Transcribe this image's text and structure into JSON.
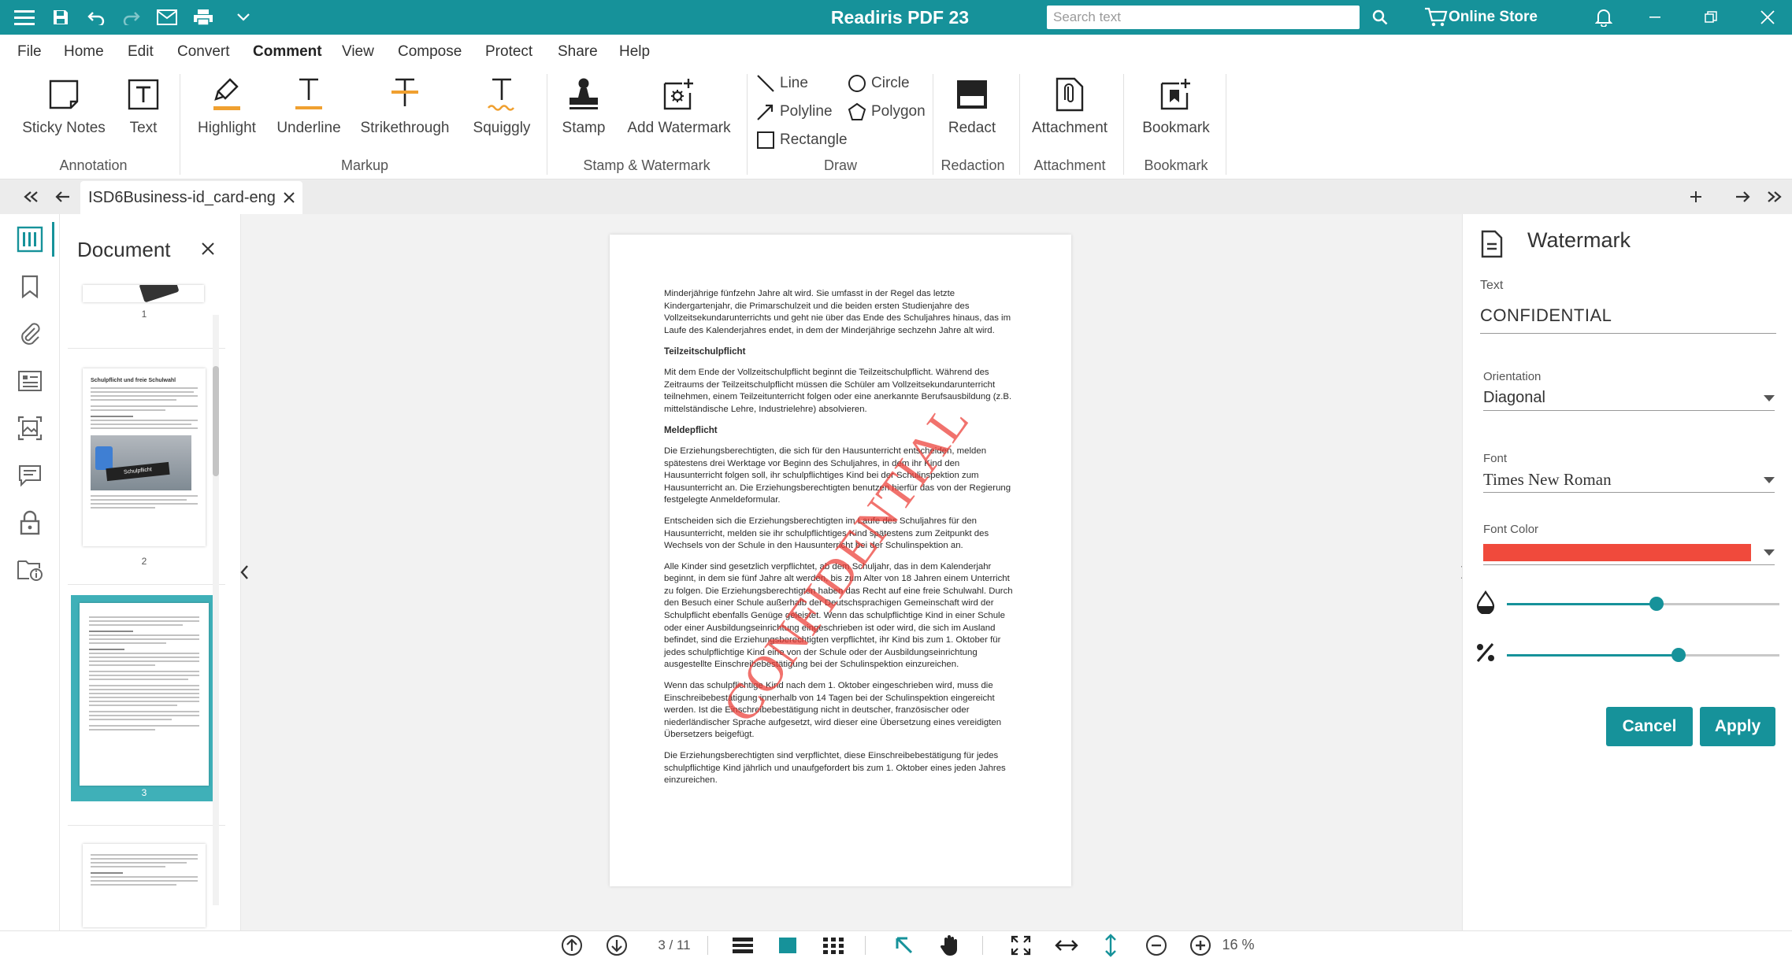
{
  "colors": {
    "accent": "#16929a",
    "watermark": "#ec3c34",
    "tab_bg": "#ececec"
  },
  "titlebar": {
    "app_title": "Readiris PDF 23",
    "search_placeholder": "Search text",
    "store_label": "Online Store",
    "icons": [
      "menu-icon",
      "save-icon",
      "undo-icon",
      "redo-icon",
      "send-icon",
      "print-icon",
      "chevron-down-icon",
      "search-icon",
      "cart-icon",
      "bell-icon",
      "minimize-icon",
      "restore-icon",
      "close-icon"
    ]
  },
  "menu": [
    "File",
    "Home",
    "Edit",
    "Convert",
    "Comment",
    "View",
    "Compose",
    "Protect",
    "Share",
    "Help"
  ],
  "menu_active": "Comment",
  "ribbon": {
    "buttons": {
      "sticky_notes": "Sticky Notes",
      "text": "Text",
      "highlight": "Highlight",
      "underline": "Underline",
      "strikethrough": "Strikethrough",
      "squiggly": "Squiggly",
      "stamp": "Stamp",
      "add_watermark": "Add Watermark",
      "line": "Line",
      "polyline": "Polyline",
      "rectangle": "Rectangle",
      "circle": "Circle",
      "polygon": "Polygon",
      "redact": "Redact",
      "attachment": "Attachment",
      "bookmark": "Bookmark"
    },
    "groups": {
      "annotation": "Annotation",
      "markup": "Markup",
      "stamp_watermark": "Stamp & Watermark",
      "draw": "Draw",
      "redaction": "Redaction",
      "attachment": "Attachment",
      "bookmark": "Bookmark"
    }
  },
  "tabs": {
    "doc_label": "ISD6Business-id_card-eng"
  },
  "doc_panel": {
    "title": "Document",
    "page_numbers": [
      "1",
      "2",
      "3"
    ],
    "thumb2_heading": "Schulpflicht und freie Schulwahl",
    "thumb2_image_label": "Schulpflicht"
  },
  "document": {
    "paragraphs": [
      "Minderjährige fünfzehn Jahre alt wird. Sie umfasst in der Regel das letzte Kindergartenjahr, die Primarschulzeit und die beiden ersten Studienjahre des Vollzeitsekundarunterrichts und geht nie über das Ende des Schuljahres hinaus, das im Laufe des Kalenderjahres endet, in dem der Minderjährige sechzehn Jahre alt wird.",
      "Teilzeitschulpflicht",
      "Mit dem Ende der Vollzeitschulpflicht beginnt die Teilzeitschulpflicht. Während des Zeitraums der Teilzeitschulpflicht müssen die Schüler am Vollzeitsekundarunterricht teilnehmen, einem Teilzeitunterricht folgen oder eine anerkannte Berufsausbildung (z.B. mittelständische Lehre, Industrielehre) absolvieren.",
      "Meldepflicht",
      "Die Erziehungsberechtigten, die sich für den Hausunterricht entscheiden, melden spätestens drei Werktage vor Beginn des Schuljahres, in dem ihr Kind den Hausunterricht folgen soll, ihr schulpflichtiges Kind bei der Schulinspektion zum Hausunterricht an. Die Erziehungsberechtigten benutzen hierfür das von der Regierung festgelegte Anmeldeformular.",
      "Entscheiden sich die Erziehungsberechtigten im Laufe des Schuljahres für den Hausunterricht, melden sie ihr schulpflichtiges Kind spätestens zum Zeitpunkt des Wechsels von der Schule in den Hausunterricht bei der Schulinspektion an.",
      "Alle Kinder sind gesetzlich verpflichtet, ab dem Schuljahr, das in dem Kalenderjahr beginnt, in dem sie fünf Jahre alt werden, bis zum Alter von 18 Jahren einem Unterricht zu folgen. Die Erziehungsberechtigten haben das Recht auf eine freie Schulwahl. Durch den Besuch einer Schule außerhalb der Deutschsprachigen Gemeinschaft wird der Schulpflicht ebenfalls Genüge geleistet. Wenn das schulpflichtige Kind in einer Schule oder einer Ausbildungseinrichtung eingeschrieben ist oder wird, die sich im Ausland befindet, sind die Erziehungsberechtigten verpflichtet, ihr Kind bis zum 1. Oktober für jedes schulpflichtige Kind eine von der Schule oder der Ausbildungseinrichtung ausgestellte Einschreibebestätigung bei der Schulinspektion einzureichen.",
      "Wenn das schulpflichtige Kind nach dem 1. Oktober eingeschrieben wird, muss die Einschreibebestätigung innerhalb von 14 Tagen bei der Schulinspektion eingereicht werden. Ist die Einschreibebestätigung nicht in deutscher, französischer oder niederländischer Sprache aufgesetzt, wird dieser eine Übersetzung eines vereidigten Übersetzers beigefügt.",
      "Die Erziehungsberechtigten sind verpflichtet, diese Einschreibebestätigung für jedes schulpflichtige Kind jährlich und unaufgefordert bis zum 1. Oktober eines jeden Jahres einzureichen."
    ],
    "watermark_text": "CONFIDENTIAL"
  },
  "watermark_panel": {
    "title": "Watermark",
    "text_label": "Text",
    "text_value": "CONFIDENTIAL",
    "orientation_label": "Orientation",
    "orientation_value": "Diagonal",
    "font_label": "Font",
    "font_value": "Times New Roman",
    "font_color_label": "Font Color",
    "font_color": "#f04a3c",
    "opacity_level": 0.55,
    "size_level": 0.63,
    "cancel_label": "Cancel",
    "apply_label": "Apply"
  },
  "statusbar": {
    "page_indicator": "3 / 11",
    "zoom": "16 %"
  }
}
